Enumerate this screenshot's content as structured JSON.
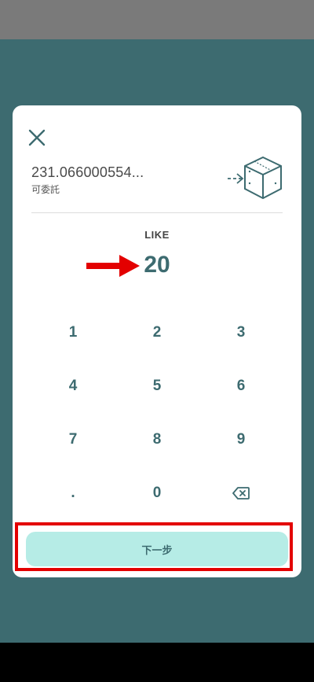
{
  "dialog": {
    "balance_amount": "231.066000554...",
    "balance_label": "可委託",
    "token_label": "LIKE",
    "amount": "20",
    "next_label": "下一步"
  },
  "keypad": {
    "keys": [
      "1",
      "2",
      "3",
      "4",
      "5",
      "6",
      "7",
      "8",
      "9",
      ".",
      "0"
    ]
  },
  "colors": {
    "accent": "#3d6b70",
    "button_bg": "#b6ece6",
    "highlight": "#e30000"
  },
  "icons": {
    "close": "close-icon",
    "delegate": "delegate-box-icon",
    "backspace": "backspace-icon",
    "annotation_arrow": "arrow-right-icon"
  }
}
